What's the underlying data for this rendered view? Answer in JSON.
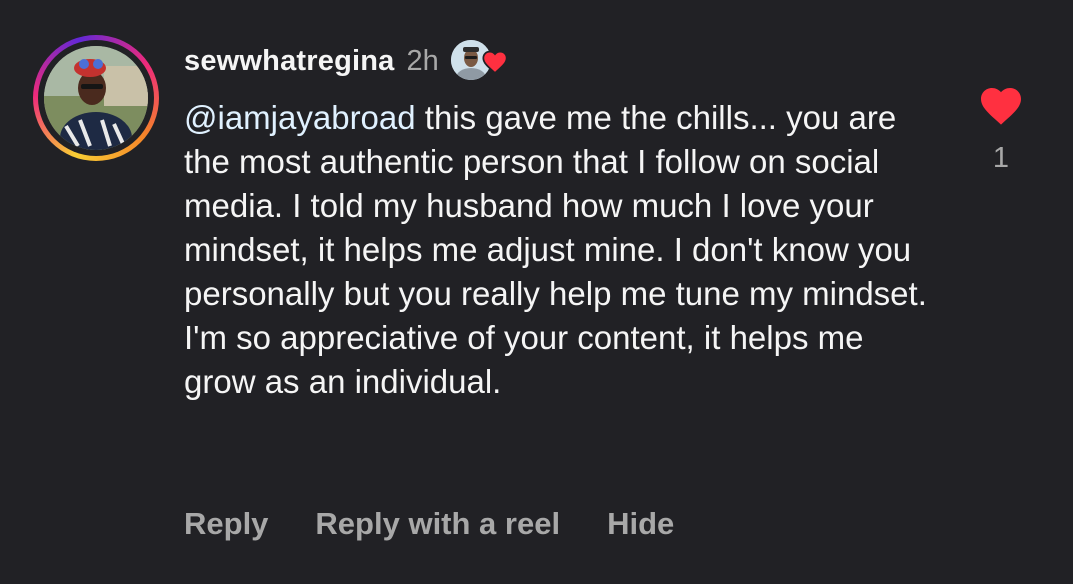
{
  "comment": {
    "username": "sewwhatregina",
    "time": "2h",
    "mention": "@iamjayabroad",
    "body": " this gave me the chills... you are the most authentic person that I follow on social media. I told my husband how much I love your mindset, it helps me adjust mine. I don't know you personally but you really help me tune my mindset. I'm so appreciative of your content, it helps me grow as an individual.",
    "like_count": "1",
    "actions": {
      "reply": "Reply",
      "reply_with_reel": "Reply with a reel",
      "hide": "Hide"
    }
  },
  "icons": {
    "like": "heart-icon",
    "creator_liked": "heart-icon"
  },
  "colors": {
    "background": "#212125",
    "text": "#f5f5f5",
    "muted": "#a8a8a8",
    "mention": "#e0f1ff",
    "heart": "#ff3040"
  }
}
